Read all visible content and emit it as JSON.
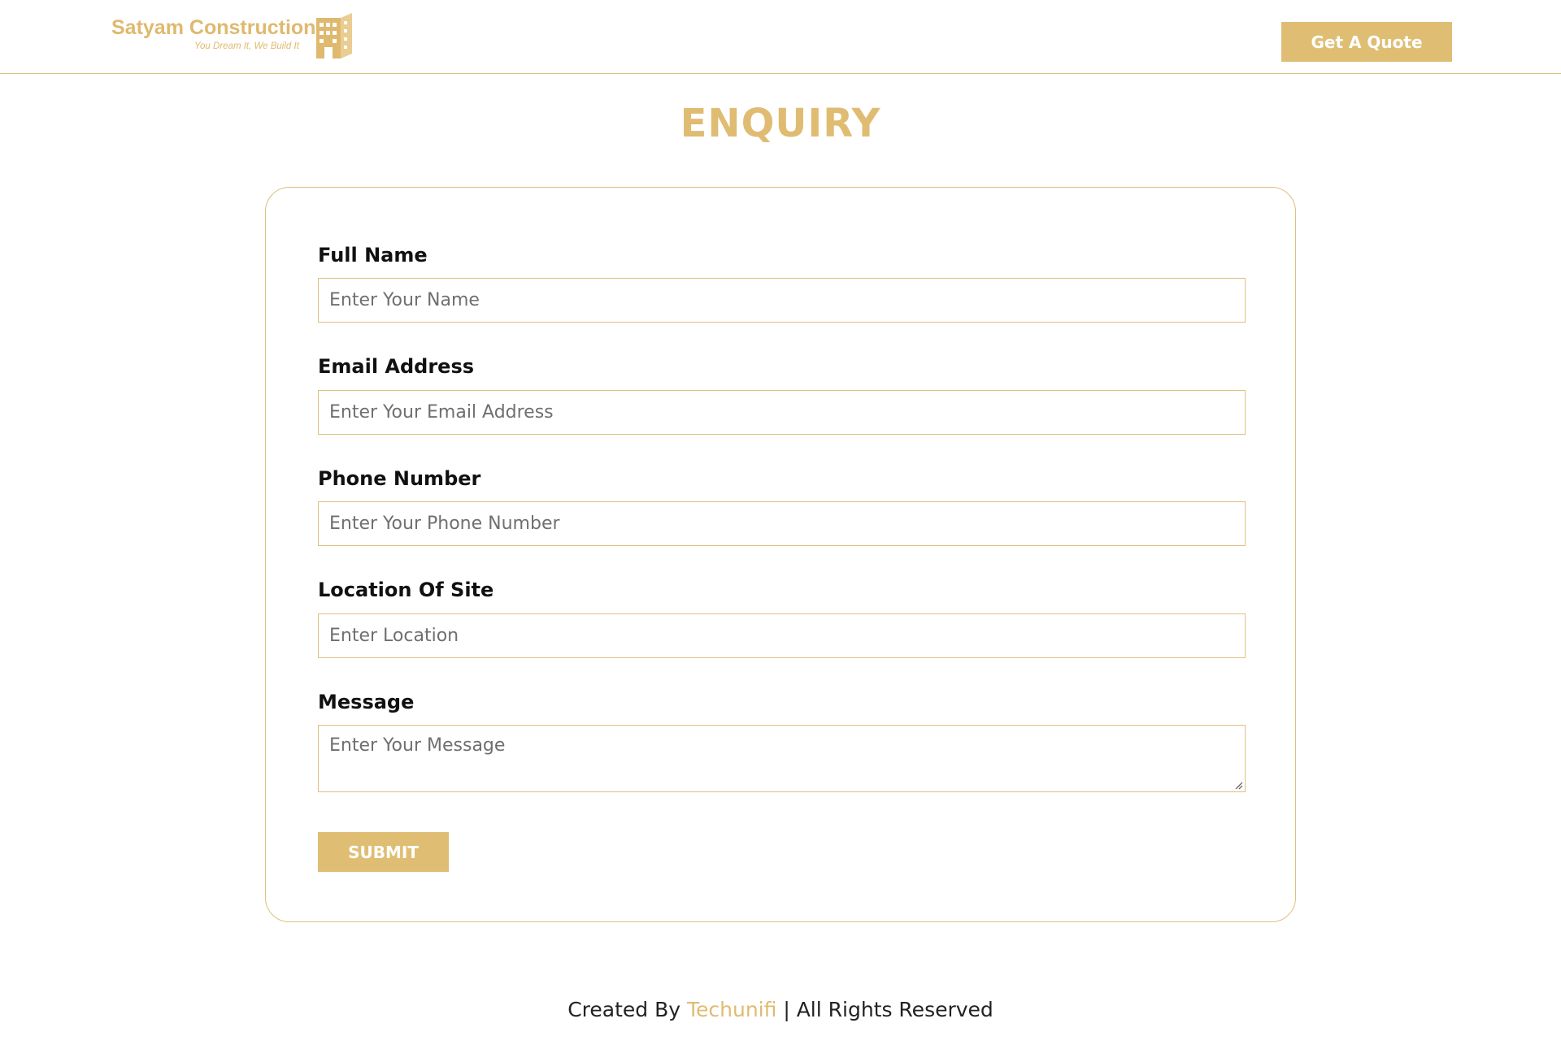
{
  "header": {
    "logo": {
      "name": "Satyam Construction",
      "tagline": "You Dream It, We Build It"
    },
    "quote_button_label": "Get A Quote"
  },
  "page": {
    "title": "ENQUIRY"
  },
  "form": {
    "fields": [
      {
        "label": "Full Name",
        "placeholder": "Enter Your Name"
      },
      {
        "label": "Email Address",
        "placeholder": "Enter Your Email Address"
      },
      {
        "label": "Phone Number",
        "placeholder": "Enter Your Phone Number"
      },
      {
        "label": "Location Of Site",
        "placeholder": "Enter Location"
      },
      {
        "label": "Message",
        "placeholder": "Enter Your Message"
      }
    ],
    "submit_label": "SUBMIT"
  },
  "footer": {
    "prefix": "Created By ",
    "brand": "Techunifi",
    "suffix": " | All Rights Reserved"
  },
  "colors": {
    "accent": "#dfbe74",
    "border": "#dfc07f",
    "text": "#111111",
    "placeholder": "#6f6f6f"
  },
  "icons": {
    "logo": "building-icon",
    "textarea_resize": "resize-grip-icon"
  }
}
